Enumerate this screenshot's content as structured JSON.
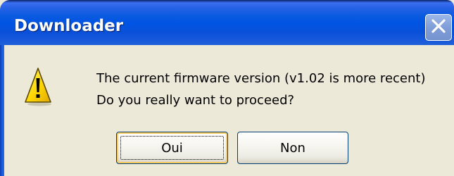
{
  "window": {
    "title": "Downloader"
  },
  "icons": {
    "warning": "warning-icon",
    "close": "close-icon"
  },
  "message": {
    "line1": "The current firmware version (v1.02 is more recent)",
    "line2": "Do you really want to proceed?"
  },
  "buttons": {
    "yes_label": "Oui",
    "no_label": "Non"
  },
  "colors": {
    "titlebar": "#0054e3",
    "dialog_background": "#ece9d8",
    "warning_fill": "#ffd700",
    "button_border": "#003c74",
    "focus_highlight": "#f6c95c"
  }
}
